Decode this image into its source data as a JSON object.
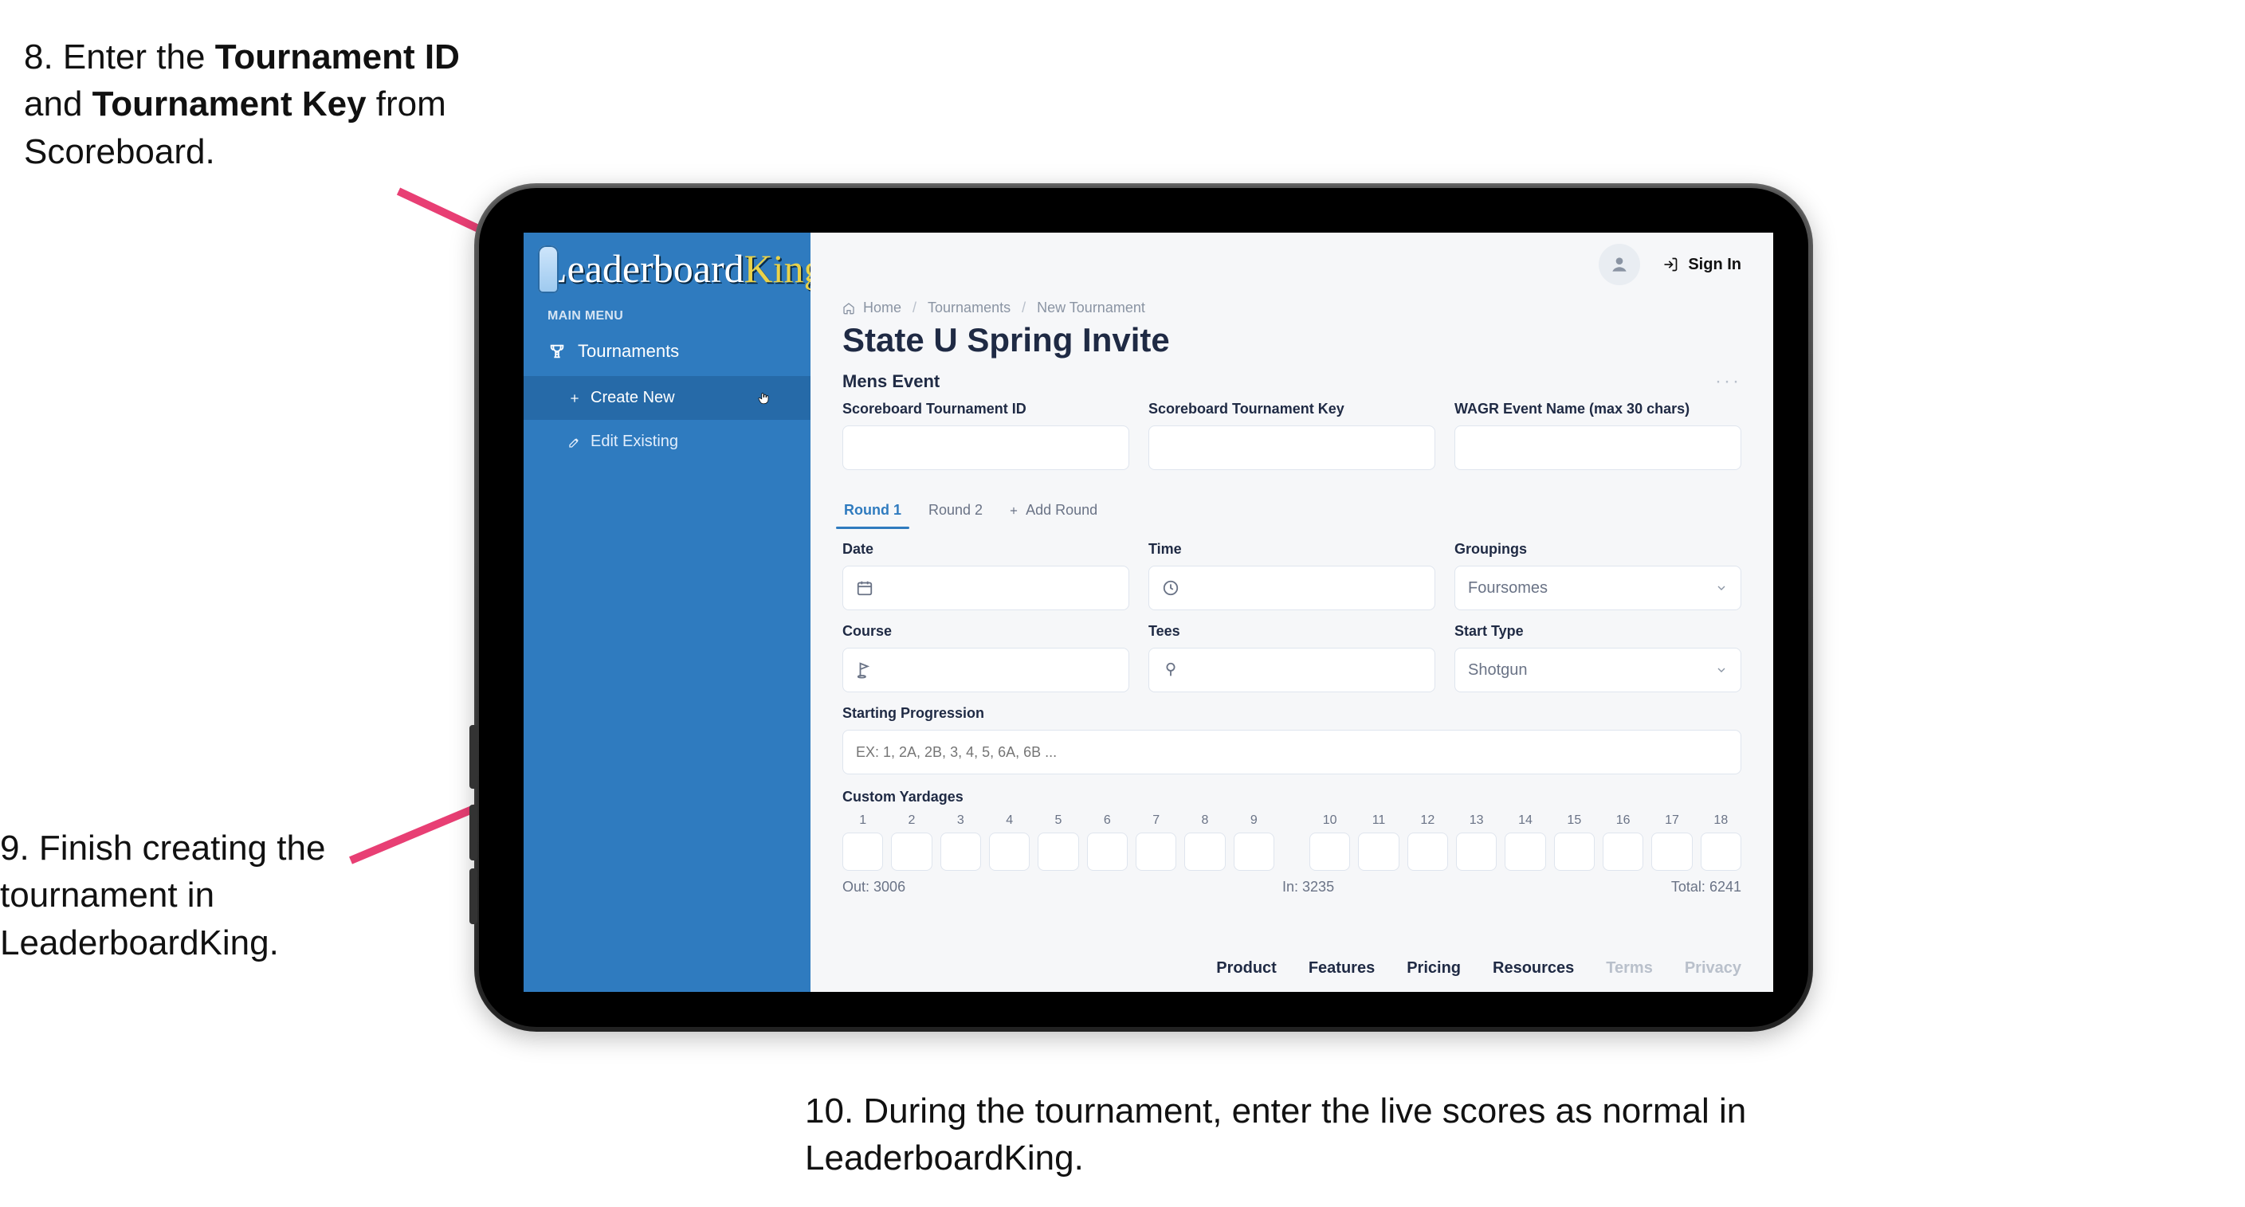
{
  "annotations": {
    "step8_pre": "8. Enter the ",
    "step8_b1": "Tournament ID",
    "step8_mid": " and ",
    "step8_b2": "Tournament Key",
    "step8_post": " from Scoreboard.",
    "step9": "9. Finish creating the tournament in LeaderboardKing.",
    "step10": "10. During the tournament, enter the live scores as normal in LeaderboardKing."
  },
  "colors": {
    "brand": "#2f7bbf",
    "accent": "#e9d24a",
    "arrow": "#e83f74"
  },
  "app": {
    "logo_left": "Leaderboard",
    "logo_right": "King",
    "sidebar": {
      "section_label": "MAIN MENU",
      "tournaments": "Tournaments",
      "create_new": "Create New",
      "edit_existing": "Edit Existing"
    },
    "topbar": {
      "signin": "Sign In"
    },
    "breadcrumbs": {
      "home": "Home",
      "item2": "Tournaments",
      "item3": "New Tournament"
    },
    "page_title": "State U Spring Invite",
    "section": "Mens Event",
    "fields": {
      "sb_id_label": "Scoreboard Tournament ID",
      "sb_key_label": "Scoreboard Tournament Key",
      "wagr_label": "WAGR Event Name (max 30 chars)"
    },
    "tabs": {
      "round1": "Round 1",
      "round2": "Round 2",
      "add": "Add Round"
    },
    "round": {
      "date_label": "Date",
      "time_label": "Time",
      "groupings_label": "Groupings",
      "groupings_value": "Foursomes",
      "course_label": "Course",
      "tees_label": "Tees",
      "start_type_label": "Start Type",
      "start_type_value": "Shotgun",
      "starting_prog_label": "Starting Progression",
      "starting_prog_placeholder": "EX: 1, 2A, 2B, 3, 4, 5, 6A, 6B ...",
      "custom_yard_label": "Custom Yardages",
      "holes": [
        "1",
        "2",
        "3",
        "4",
        "5",
        "6",
        "7",
        "8",
        "9",
        "10",
        "11",
        "12",
        "13",
        "14",
        "15",
        "16",
        "17",
        "18"
      ],
      "out_label": "Out:",
      "out_value": "3006",
      "in_label": "In:",
      "in_value": "3235",
      "total_label": "Total:",
      "total_value": "6241"
    },
    "footer": {
      "product": "Product",
      "features": "Features",
      "pricing": "Pricing",
      "resources": "Resources",
      "terms": "Terms",
      "privacy": "Privacy"
    }
  }
}
